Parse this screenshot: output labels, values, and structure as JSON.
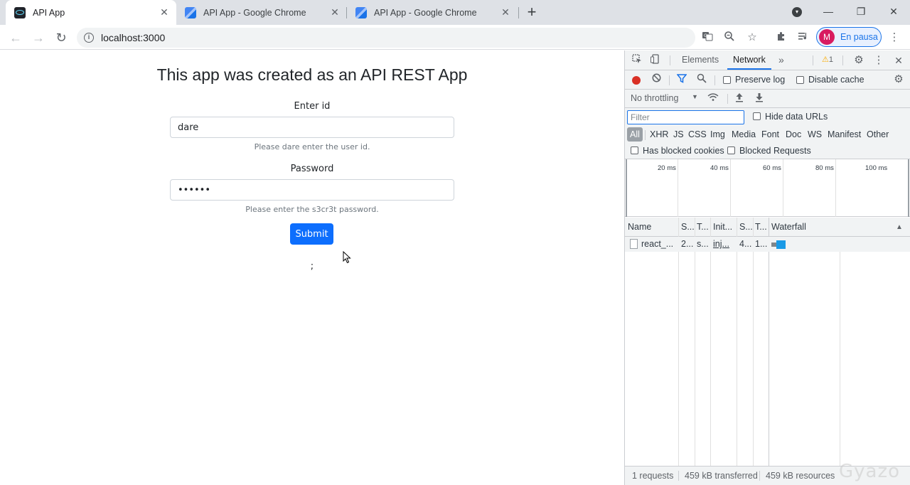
{
  "browser": {
    "tabs": [
      {
        "title": "API App",
        "active": true
      },
      {
        "title": "API App - Google Chrome",
        "active": false
      },
      {
        "title": "API App - Google Chrome",
        "active": false
      }
    ],
    "url": "localhost:3000",
    "profile": {
      "initial": "M",
      "status": "En pausa"
    }
  },
  "page": {
    "heading": "This app was created as an API REST App",
    "id_label": "Enter id",
    "id_value": "dare",
    "id_hint": "Please dare enter the user id.",
    "password_label": "Password",
    "password_value": "s3cr3t",
    "password_hint": "Please enter the s3cr3t password.",
    "submit_label": "Submit",
    "result_text": ";"
  },
  "devtools": {
    "tabs": [
      "Elements",
      "Network"
    ],
    "active_tab": "Network",
    "more": "»",
    "warning_count": "1",
    "preserve_log": "Preserve log",
    "disable_cache": "Disable cache",
    "throttling": "No throttling",
    "filter_placeholder": "Filter",
    "hide_data_urls": "Hide data URLs",
    "type_filters": [
      "All",
      "XHR",
      "JS",
      "CSS",
      "Img",
      "Media",
      "Font",
      "Doc",
      "WS",
      "Manifest",
      "Other"
    ],
    "has_blocked_cookies": "Has blocked cookies",
    "blocked_requests": "Blocked Requests",
    "overview_ticks": [
      "20 ms",
      "40 ms",
      "60 ms",
      "80 ms",
      "100 ms"
    ],
    "columns": [
      "Name",
      "S...",
      "T...",
      "Init...",
      "S...",
      "T...",
      "Waterfall"
    ],
    "sort_indicator": "▲",
    "requests": [
      {
        "name": "react_...",
        "status": "2...",
        "type": "s...",
        "initiator": "inj...",
        "size": "4...",
        "time": "1..."
      }
    ],
    "status": {
      "requests": "1 requests",
      "transferred": "459 kB transferred",
      "resources": "459 kB resources"
    }
  },
  "colors": {
    "accent": "#1a73e8",
    "submit": "#0d6efd",
    "record": "#d93025",
    "profile_avatar": "#d81b60"
  },
  "watermark": "Gyazo"
}
